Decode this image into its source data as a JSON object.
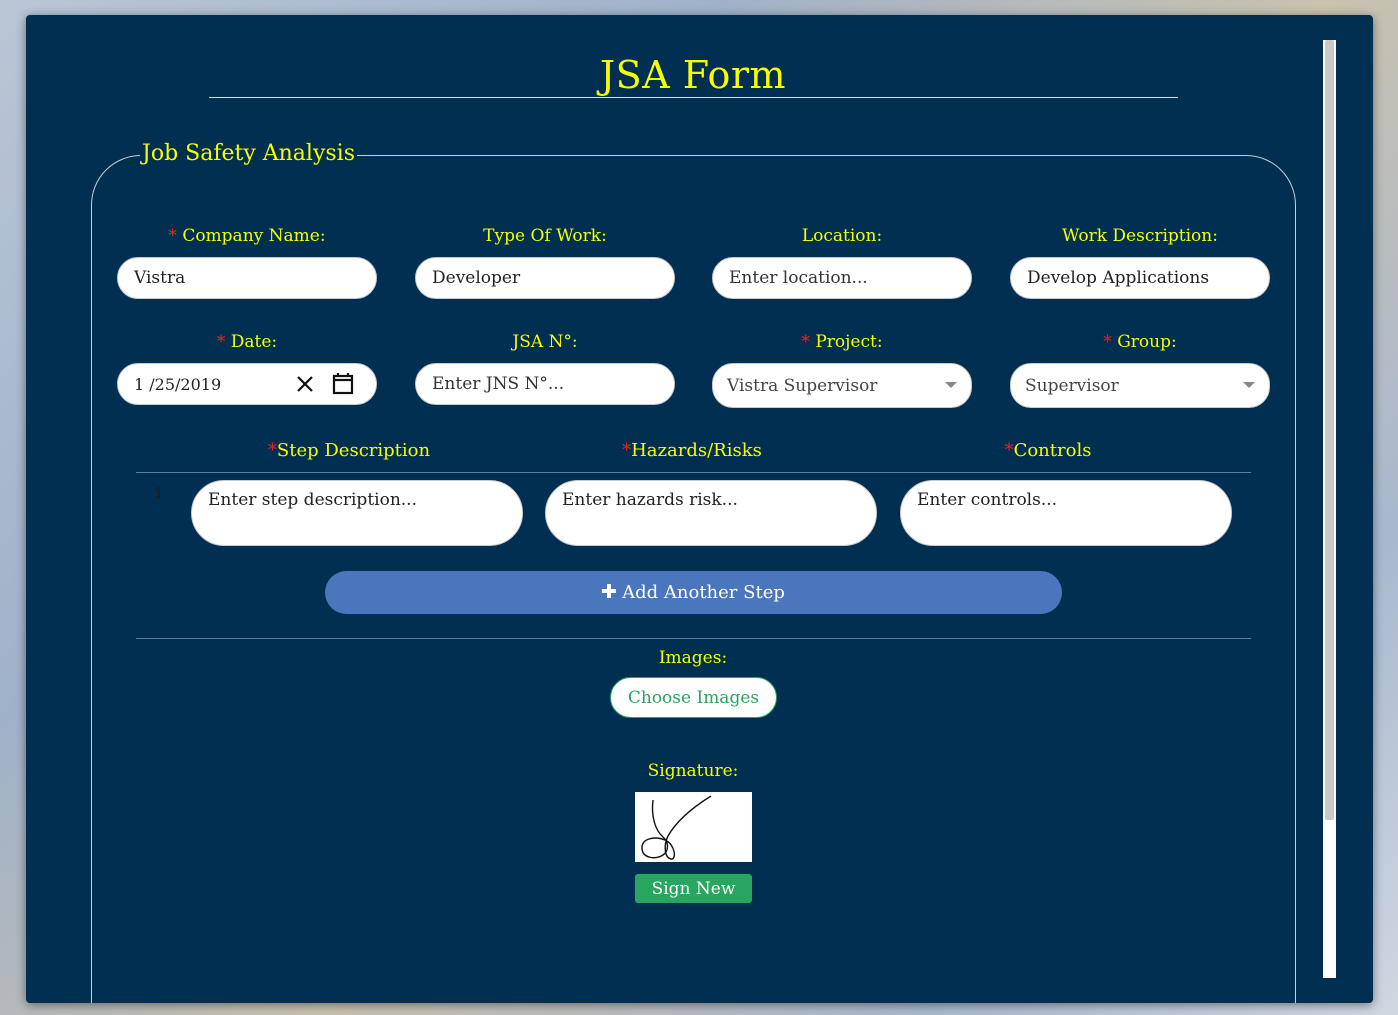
{
  "page": {
    "title": "JSA Form",
    "section_legend": "Job Safety Analysis"
  },
  "fields": {
    "company_name": {
      "label": "Company Name:",
      "required": true,
      "value": "Vistra"
    },
    "type_of_work": {
      "label": "Type Of Work:",
      "required": false,
      "value": "Developer"
    },
    "location": {
      "label": "Location:",
      "required": false,
      "value": "",
      "placeholder": "Enter location..."
    },
    "work_description": {
      "label": "Work Description:",
      "required": false,
      "value": "Develop Applications"
    },
    "date": {
      "label": "Date:",
      "required": true,
      "month": "1",
      "day": "25",
      "year": "2019"
    },
    "jsa_no": {
      "label": "JSA N°:",
      "required": false,
      "value": "",
      "placeholder": "Enter JNS N°..."
    },
    "project": {
      "label": "Project:",
      "required": true,
      "value": "Vistra Supervisor"
    },
    "group": {
      "label": "Group:",
      "required": true,
      "value": "Supervisor"
    }
  },
  "steps": {
    "columns": [
      {
        "label": "Step Description",
        "required": true
      },
      {
        "label": "Hazards/Risks",
        "required": true
      },
      {
        "label": "Controls",
        "required": true
      }
    ],
    "rows": [
      {
        "number": "1",
        "step_placeholder": "Enter step description...",
        "hazard_placeholder": "Enter hazards risk...",
        "controls_placeholder": "Enter controls..."
      }
    ],
    "add_button_label": "Add Another Step"
  },
  "images": {
    "label": "Images:",
    "button_label": "Choose Images"
  },
  "signature": {
    "label": "Signature:",
    "button_label": "Sign New"
  },
  "colors": {
    "panel_bg": "#002f52",
    "label_yellow": "#f5ff00",
    "required_red": "#ff1a1a",
    "add_button_blue": "#4a76be",
    "green": "#28a55f"
  },
  "icons": [
    "clear-date-icon",
    "calendar-icon",
    "chevron-down-icon",
    "plus-icon"
  ]
}
